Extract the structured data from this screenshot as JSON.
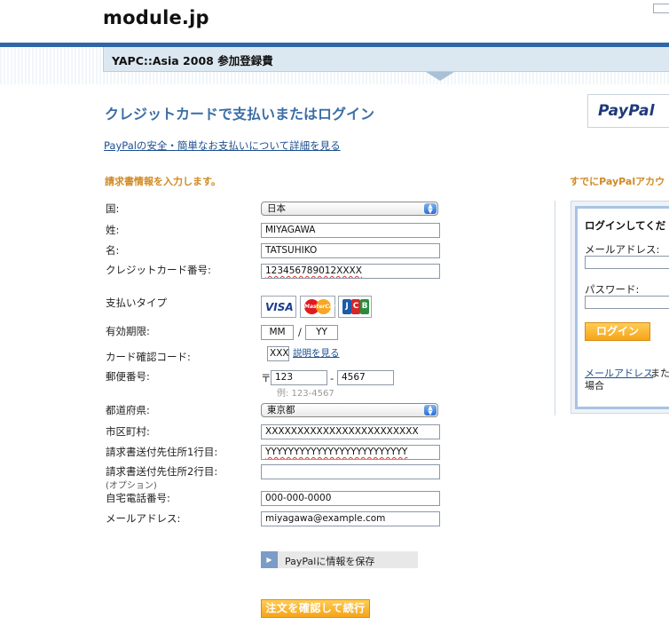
{
  "header": {
    "site_title": "module.jp",
    "merchant_title": "YAPC::Asia 2008 参加登録費"
  },
  "main": {
    "page_title": "クレジットカードで支払いまたはログイン",
    "paypal_logo_text": "PayPal",
    "info_link": "PayPalの安全・簡単なお支払いについて詳細を見る",
    "section_heading": "請求書情報を入力します。"
  },
  "form": {
    "country_label": "国:",
    "country_value": "日本",
    "last_name_label": "姓:",
    "last_name_value": "MIYAGAWA",
    "first_name_label": "名:",
    "first_name_value": "TATSUHIKO",
    "card_number_label": "クレジットカード番号:",
    "card_number_value": "123456789012XXXX",
    "payment_type_label": "支払いタイプ",
    "cards": [
      "VISA",
      "MasterCard",
      "JCB"
    ],
    "expiry_label": "有効期限:",
    "expiry_month": "MM",
    "expiry_separator": "/",
    "expiry_year": "YY",
    "cvv_label": "カード確認コード:",
    "cvv_value": "XXX",
    "cvv_link": "説明を見る",
    "postal_label": "郵便番号:",
    "postal_mark": "〒",
    "postal_part1": "123",
    "postal_separator": "-",
    "postal_part2": "4567",
    "postal_hint": "例: 123-4567",
    "prefecture_label": "都道府県:",
    "prefecture_value": "東京都",
    "city_label": "市区町村:",
    "city_value": "XXXXXXXXXXXXXXXXXXXXXXXX",
    "address1_label": "請求書送付先住所1行目:",
    "address1_value": "YYYYYYYYYYYYYYYYYYYYYYYYY",
    "address2_label": "請求書送付先住所2行目:",
    "address2_sub": "(オプション)",
    "address2_value": "",
    "phone_label": "自宅電話番号:",
    "phone_value": "000-000-0000",
    "email_label": "メールアドレス:",
    "email_value": "miyagawa@example.com",
    "save_button": "PayPalに情報を保存",
    "continue_button": "注文を確認して続行"
  },
  "login": {
    "heading": "すでにPayPalアカウ",
    "title": "ログインしてくだ",
    "email_label": "メールアドレス:",
    "password_label": "パスワード:",
    "login_button": "ログイン",
    "forgot_link": "メールアドレス",
    "forgot_rest": "また",
    "forgot_line2": "場合"
  },
  "colors": {
    "accent_blue": "#3b6ea5",
    "header_stripe": "#2e67a8",
    "section_orange": "#d08a24",
    "button_orange": "#f5a418"
  },
  "icons": {
    "select_arrows": "up-down-arrows-icon",
    "save_arrow": "play-arrow-icon"
  }
}
